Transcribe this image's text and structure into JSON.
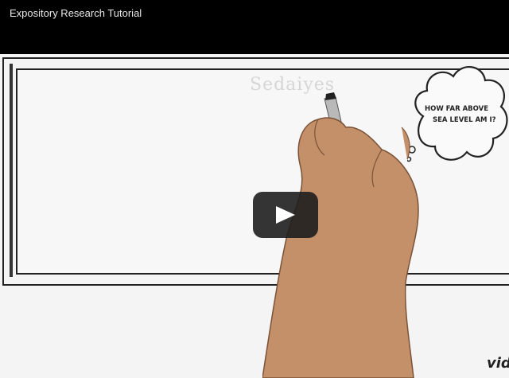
{
  "video": {
    "title": "Expository Research Tutorial",
    "ghost_text": "Sedaiyes",
    "cloud_line1": "HOW FAR ABOVE",
    "cloud_line2": "SEA LEVEL AM I?",
    "brand": "vid"
  },
  "icons": {
    "play": "play-icon",
    "cloud": "thought-cloud-icon",
    "hand": "hand-with-marker-icon"
  },
  "colors": {
    "topbar": "#000000",
    "play_button_bg": "#1e1e1e",
    "whiteboard": "#f4f4f4"
  }
}
